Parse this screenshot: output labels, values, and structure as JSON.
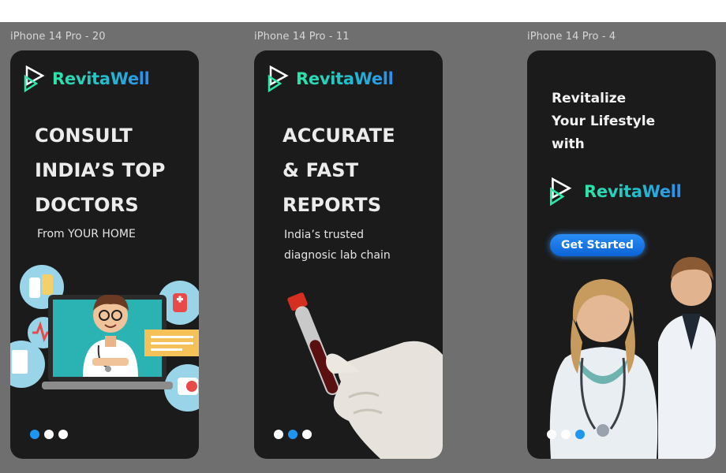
{
  "canvas": {
    "background": "#6f6f6f"
  },
  "colors": {
    "accent_blue": "#1e96f0",
    "brand_green": "#2ee6a6",
    "card_bg": "#1b1b1b"
  },
  "frames": [
    {
      "label": "iPhone 14 Pro - 20",
      "brand": "RevitaWell",
      "headline": [
        "CONSULT",
        "INDIA’S TOP",
        "DOCTORS"
      ],
      "subtitle": "From YOUR HOME",
      "illustration": "doctor-video-call-illustration",
      "active_dot": 0
    },
    {
      "label": "iPhone 14 Pro - 11",
      "brand": "RevitaWell",
      "headline": [
        "ACCURATE",
        "& FAST",
        "REPORTS"
      ],
      "subtitle": [
        "India’s trusted",
        "diagnosic lab chain"
      ],
      "illustration": "blood-sample-tube-photo",
      "active_dot": 1
    },
    {
      "label": "iPhone 14 Pro - 4",
      "tagline": [
        "Revitalize",
        "Your Lifestyle",
        "with"
      ],
      "brand": "RevitaWell",
      "cta": "Get Started",
      "illustration": "doctors-photo",
      "active_dot": 2
    }
  ]
}
